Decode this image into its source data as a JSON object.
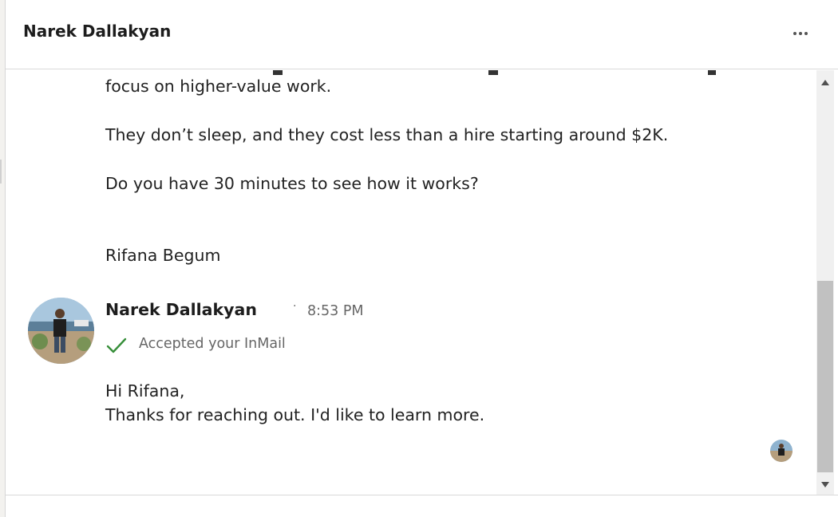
{
  "header": {
    "title": "Narek Dallakyan",
    "more_icon": "ellipsis-icon"
  },
  "thread": {
    "previous_message": {
      "line_clipped": "work so your team can focus on higher-value work...",
      "line1": "focus on higher-value work.",
      "line2": "They don’t sleep, and they cost less than a hire starting around $2K.",
      "line3": "Do you have 30 minutes to see how it works?",
      "signature": "Rifana Begum"
    },
    "reply": {
      "sender": "Narek Dallakyan",
      "separator": "·",
      "time": "8:53 PM",
      "status": "Accepted your InMail",
      "status_icon": "checkmark-icon",
      "line1": "Hi Rifana,",
      "line2": "Thanks for reaching out. I'd like to learn more."
    }
  },
  "colors": {
    "check_green": "#378f3a",
    "muted_text": "#666666",
    "border": "#d9d9d9",
    "scroll_thumb": "#c1c1c1"
  }
}
